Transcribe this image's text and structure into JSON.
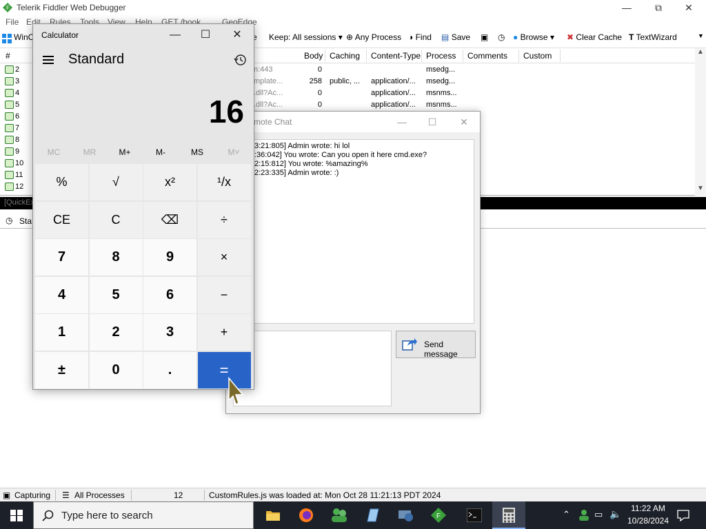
{
  "fiddler": {
    "title": "Telerik Fiddler Web Debugger",
    "menu": [
      "File",
      "Edit",
      "Rules",
      "Tools",
      "View",
      "Help",
      "GET /book",
      "GeoEdge"
    ],
    "toolbar": {
      "wincfg": "WinC",
      "replay": "e",
      "keep": "Keep: All sessions",
      "any_process": "Any Process",
      "find": "Find",
      "save": "Save",
      "browse": "Browse",
      "clear_cache": "Clear Cache",
      "textwizard": "TextWizard"
    },
    "columns": [
      "#",
      "Body",
      "Caching",
      "Content-Type",
      "Process",
      "Comments",
      "Custom"
    ],
    "sessions": [
      {
        "id": "2",
        "url": "n:443",
        "body": "0",
        "caching": "",
        "content_type": "",
        "process": "msedg..."
      },
      {
        "id": "3",
        "url": "mplate...",
        "body": "258",
        "caching": "public, ...",
        "content_type": "application/...",
        "process": "msedg..."
      },
      {
        "id": "4",
        "url": ".dll?Ac...",
        "body": "0",
        "caching": "",
        "content_type": "application/...",
        "process": "msnms..."
      },
      {
        "id": "5",
        "url": ".dll?Ac...",
        "body": "0",
        "caching": "",
        "content_type": "application/...",
        "process": "msnms..."
      },
      {
        "id": "6",
        "url": "",
        "body": "",
        "caching": "",
        "content_type": "",
        "process": ""
      },
      {
        "id": "7",
        "url": "",
        "body": "",
        "caching": "",
        "content_type": "",
        "process": ""
      },
      {
        "id": "8",
        "url": "",
        "body": "",
        "caching": "",
        "content_type": "",
        "process": ""
      },
      {
        "id": "9",
        "url": "",
        "body": "",
        "caching": "",
        "content_type": "",
        "process": ""
      },
      {
        "id": "10",
        "url": "",
        "body": "",
        "caching": "",
        "content_type": "",
        "process": ""
      },
      {
        "id": "11",
        "url": "",
        "body": "",
        "caching": "",
        "content_type": "",
        "process": ""
      },
      {
        "id": "12",
        "url": "",
        "body": "",
        "caching": "",
        "content_type": "",
        "process": ""
      }
    ],
    "quickexec_placeholder": "[QuickExe",
    "inspector_tab": "Sta",
    "status": {
      "capturing": "Capturing",
      "processes": "All Processes",
      "count": "12",
      "message": "CustomRules.js was loaded at: Mon Oct 28 11:21:13 PDT 2024"
    }
  },
  "chat": {
    "title": "mote Chat",
    "messages": [
      "3:21:805] Admin wrote: hi lol",
      ":36:042] You wrote: Can you open it here cmd.exe?",
      "2:15:812] You wrote: %amazing%",
      "2:23:335] Admin wrote: :)"
    ],
    "send_label": "Send message"
  },
  "calculator": {
    "title": "Calculator",
    "mode": "Standard",
    "display": "16",
    "memory": [
      {
        "label": "MC",
        "enabled": false
      },
      {
        "label": "MR",
        "enabled": false
      },
      {
        "label": "M+",
        "enabled": true
      },
      {
        "label": "M-",
        "enabled": true
      },
      {
        "label": "MS",
        "enabled": true
      },
      {
        "label": "M˅",
        "enabled": false
      }
    ],
    "keys": [
      [
        "%",
        "√",
        "x²",
        "¹/x"
      ],
      [
        "CE",
        "C",
        "⌫",
        "÷"
      ],
      [
        "7",
        "8",
        "9",
        "×"
      ],
      [
        "4",
        "5",
        "6",
        "−"
      ],
      [
        "1",
        "2",
        "3",
        "+"
      ],
      [
        "±",
        "0",
        ".",
        "="
      ]
    ]
  },
  "taskbar": {
    "search_placeholder": "Type here to search",
    "time": "11:22 AM",
    "date": "10/28/2024",
    "apps": [
      "file-explorer-icon",
      "firefox-icon",
      "users-icon",
      "notepad-icon",
      "remote-icon",
      "fiddler-icon",
      "terminal-icon",
      "calculator-icon"
    ]
  },
  "colors": {
    "accent": "#2864c8",
    "taskbar": "#1c2029"
  }
}
